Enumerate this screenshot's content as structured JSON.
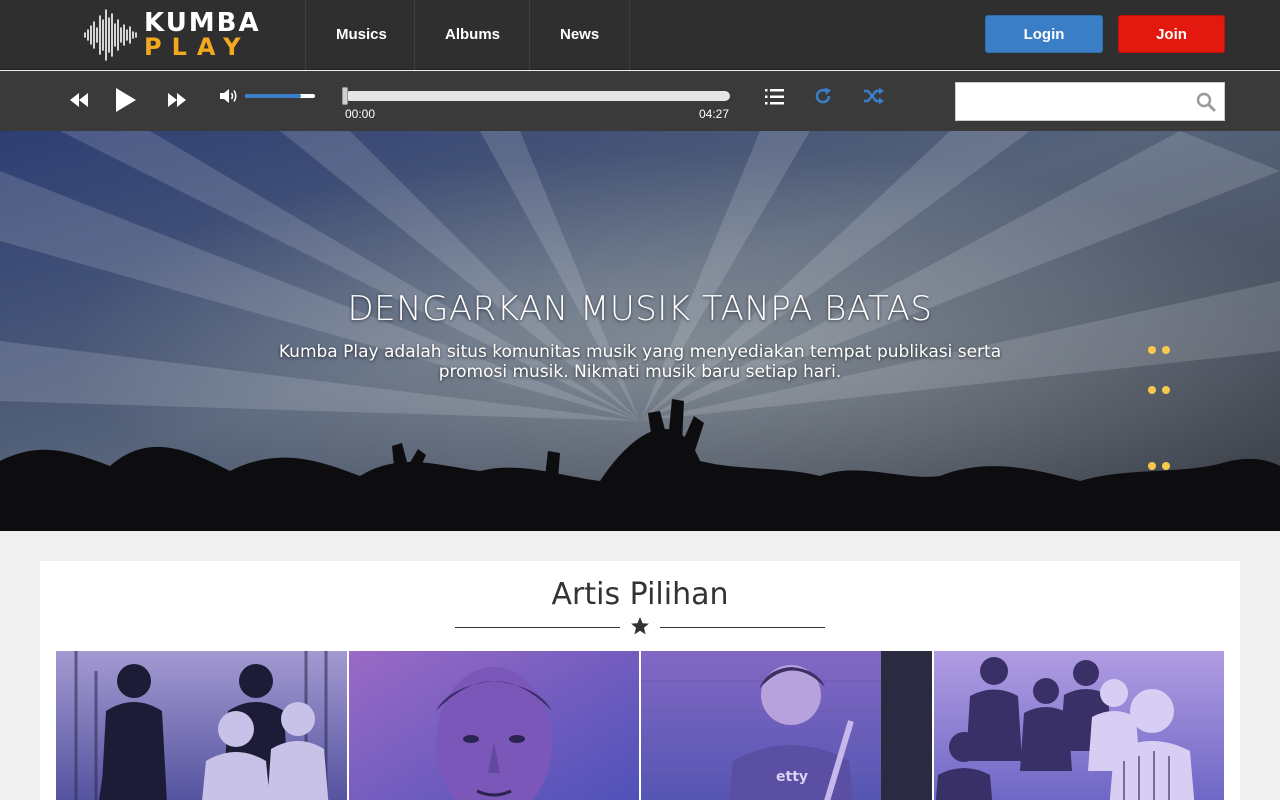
{
  "brand": {
    "name_top": "KUMBA",
    "name_bottom": "PLAY",
    "accent_color": "#f4a81d"
  },
  "nav": {
    "items": [
      {
        "label": "Musics"
      },
      {
        "label": "Albums"
      },
      {
        "label": "News"
      }
    ],
    "login_label": "Login",
    "join_label": "Join",
    "login_color": "#3a7fc6",
    "join_color": "#e3180e"
  },
  "player": {
    "current_time": "00:00",
    "total_time": "04:27",
    "progress": 0,
    "volume": 0.8,
    "icons": [
      "rewind-icon",
      "play-icon",
      "fast-forward-icon",
      "volume-icon",
      "playlist-icon",
      "repeat-icon",
      "shuffle-icon"
    ],
    "accent_color": "#3a7fc6"
  },
  "search": {
    "placeholder": "",
    "value": "",
    "icon": "search-icon"
  },
  "hero": {
    "title": "DENGARKAN MUSIK TANPA BATAS",
    "text": "Kumba Play adalah situs komunitas musik yang menyediakan tempat publikasi serta promosi musik. Nikmati musik baru setiap hari."
  },
  "featured": {
    "title": "Artis Pilihan",
    "divider_icon": "star-icon",
    "artists": [
      {
        "photo": "band-photo-1"
      },
      {
        "photo": "artist-portrait-2"
      },
      {
        "photo": "artist-guitar-3"
      },
      {
        "photo": "band-photo-4"
      }
    ]
  }
}
